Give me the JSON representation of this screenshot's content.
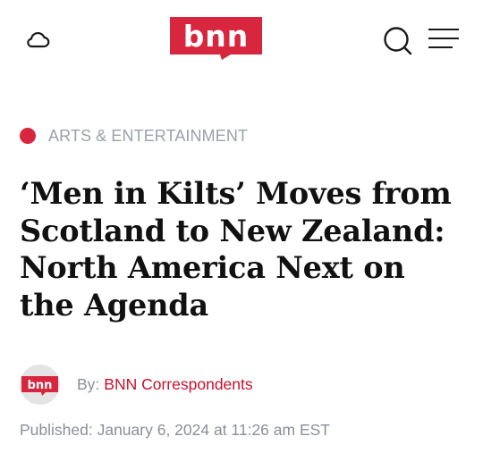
{
  "header": {
    "logo_text": "bnn",
    "weather_icon": "cloud-icon",
    "search_icon": "search-icon",
    "menu_icon": "hamburger-menu-icon",
    "brand_color": "#d7263d"
  },
  "article": {
    "category": "ARTS & ENTERTAINMENT",
    "headline": "‘Men in Kilts’ Moves from Scotland to New Zealand: North America Next on the Agenda",
    "author": {
      "by_label": "By:",
      "name": "BNN Correspondents",
      "avatar_text": "bnn"
    },
    "published": "Published: January 6, 2024 at 11:26 am EST"
  },
  "colors": {
    "accent_red": "#d7263d",
    "muted_text": "#8a8f99",
    "category_text": "#9aa0ac",
    "link_red": "#c8102e"
  }
}
